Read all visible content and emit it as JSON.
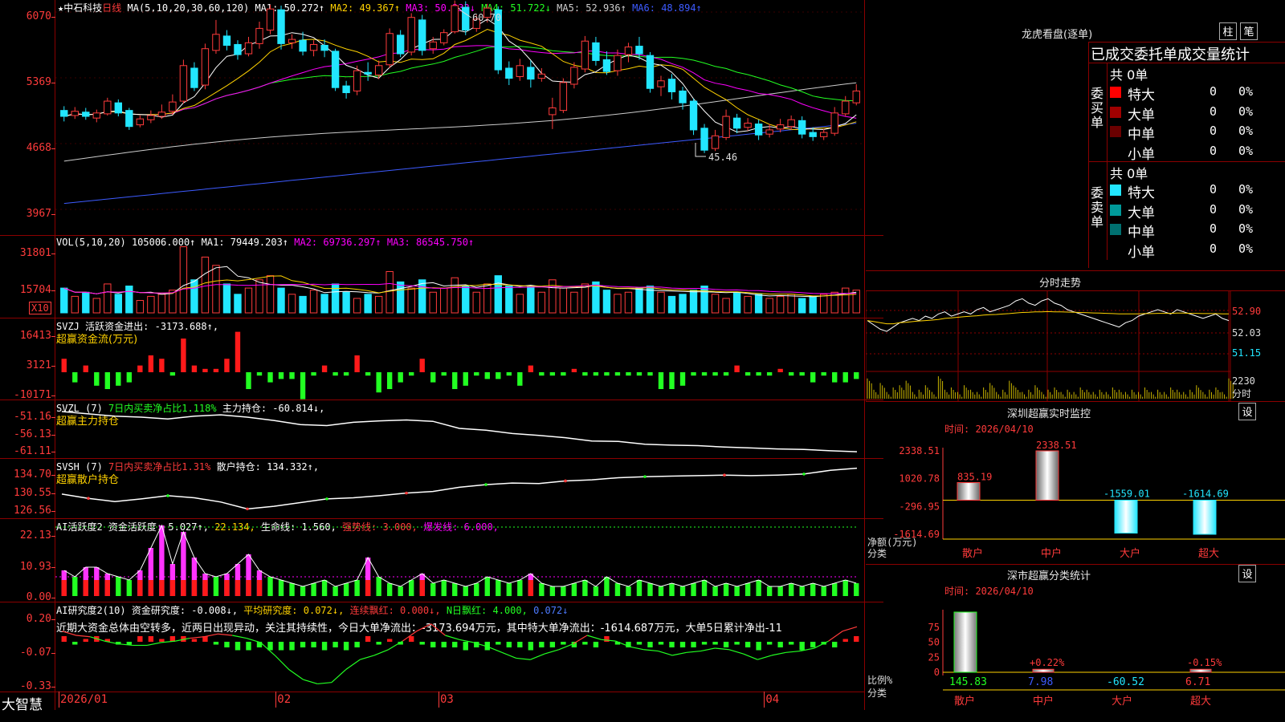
{
  "stock": {
    "name": "中石科技",
    "period": "日线",
    "ma_label": "MA(5,10,20,30,60,120)",
    "ma": [
      {
        "label": "MA1: 50.272↑",
        "color": "#ffffff"
      },
      {
        "label": "MA2: 49.367↑",
        "color": "#ffd200"
      },
      {
        "label": "MA3: 50.233↓",
        "color": "#ff00ff"
      },
      {
        "label": "MA4: 51.722↓",
        "color": "#22ff22"
      },
      {
        "label": "MA5: 52.936↑",
        "color": "#cccccc"
      },
      {
        "label": "MA6: 48.894↑",
        "color": "#3d5bff"
      }
    ],
    "price_ticks": [
      "6070",
      "5369",
      "4668",
      "3967"
    ],
    "high_label": "60.70",
    "low_label": "45.46",
    "candles": [
      [
        50.5,
        49.8,
        51.0,
        49.2
      ],
      [
        49.9,
        50.4,
        50.9,
        49.5
      ],
      [
        50.3,
        49.8,
        50.8,
        49.4
      ],
      [
        49.6,
        50.2,
        50.6,
        49.1
      ],
      [
        50.1,
        51.6,
        52.0,
        49.9
      ],
      [
        51.4,
        50.2,
        51.8,
        49.8
      ],
      [
        50.5,
        48.6,
        50.8,
        48.2
      ],
      [
        48.8,
        49.5,
        49.9,
        48.5
      ],
      [
        49.4,
        49.9,
        50.5,
        49.0
      ],
      [
        49.8,
        50.3,
        51.2,
        49.5
      ],
      [
        50.4,
        51.5,
        52.4,
        50.0
      ],
      [
        51.6,
        55.8,
        56.5,
        51.3
      ],
      [
        55.5,
        53.2,
        56.2,
        52.8
      ],
      [
        53.5,
        57.8,
        58.4,
        53.0
      ],
      [
        57.6,
        59.5,
        61.2,
        57.2
      ],
      [
        59.3,
        58.2,
        60.0,
        57.6
      ],
      [
        58.3,
        57.1,
        58.8,
        56.5
      ],
      [
        57.2,
        58.5,
        59.2,
        56.9
      ],
      [
        58.4,
        60.2,
        61.0,
        57.8
      ],
      [
        60.0,
        62.5,
        63.0,
        59.5
      ],
      [
        62.4,
        58.4,
        62.9,
        57.7
      ],
      [
        58.5,
        58.9,
        59.5,
        57.8
      ],
      [
        58.8,
        57.5,
        59.8,
        57.0
      ],
      [
        57.6,
        58.3,
        58.8,
        56.9
      ],
      [
        58.2,
        57.6,
        58.9,
        56.8
      ],
      [
        57.5,
        53.2,
        57.8,
        52.8
      ],
      [
        53.4,
        52.6,
        54.0,
        51.9
      ],
      [
        52.8,
        55.2,
        55.8,
        52.3
      ],
      [
        55.0,
        54.8,
        56.2,
        54.0
      ],
      [
        54.7,
        55.8,
        56.4,
        54.2
      ],
      [
        55.9,
        59.6,
        60.2,
        55.5
      ],
      [
        59.4,
        57.2,
        60.0,
        56.8
      ],
      [
        57.4,
        61.5,
        62.0,
        57.0
      ],
      [
        61.2,
        57.6,
        61.8,
        57.0
      ],
      [
        57.8,
        58.6,
        59.2,
        57.2
      ],
      [
        58.5,
        59.7,
        60.1,
        58.2
      ],
      [
        59.8,
        62.9,
        63.5,
        59.6
      ],
      [
        62.7,
        60.0,
        63.4,
        59.4
      ],
      [
        60.2,
        61.3,
        61.8,
        59.8
      ],
      [
        61.5,
        62.6,
        63.1,
        60.9
      ],
      [
        62.4,
        55.3,
        62.8,
        54.8
      ],
      [
        55.5,
        54.3,
        56.3,
        53.5
      ],
      [
        54.5,
        55.8,
        56.6,
        54.0
      ],
      [
        55.6,
        54.2,
        56.4,
        53.2
      ],
      [
        54.3,
        54.8,
        55.5,
        53.9
      ],
      [
        50.0,
        50.8,
        52.0,
        48.3
      ],
      [
        50.5,
        53.8,
        54.3,
        50.2
      ],
      [
        53.6,
        55.6,
        56.2,
        53.1
      ],
      [
        55.4,
        58.7,
        59.3,
        55.0
      ],
      [
        58.5,
        56.4,
        59.2,
        55.8
      ],
      [
        56.5,
        55.1,
        57.5,
        54.7
      ],
      [
        55.2,
        57.0,
        57.7,
        54.6
      ],
      [
        57.1,
        58.0,
        58.5,
        56.2
      ],
      [
        58.1,
        57.2,
        59.2,
        56.5
      ],
      [
        57.0,
        53.1,
        57.4,
        52.6
      ],
      [
        53.3,
        54.0,
        54.6,
        52.2
      ],
      [
        54.2,
        52.7,
        54.8,
        51.8
      ],
      [
        52.8,
        51.4,
        53.3,
        50.6
      ],
      [
        51.6,
        48.2,
        51.9,
        47.6
      ],
      [
        48.4,
        45.8,
        48.9,
        45.46
      ],
      [
        46.0,
        47.5,
        48.2,
        45.7
      ],
      [
        47.3,
        49.8,
        50.6,
        47.0
      ],
      [
        49.6,
        48.4,
        50.1,
        47.8
      ],
      [
        48.5,
        49.0,
        49.6,
        48.1
      ],
      [
        48.9,
        47.6,
        49.4,
        47.0
      ],
      [
        47.7,
        48.2,
        48.9,
        47.3
      ],
      [
        48.3,
        48.8,
        49.5,
        47.9
      ],
      [
        48.6,
        49.4,
        49.9,
        48.2
      ],
      [
        49.3,
        47.7,
        49.8,
        47.2
      ],
      [
        47.9,
        47.4,
        48.5,
        46.9
      ],
      [
        47.4,
        47.9,
        48.3,
        47.0
      ],
      [
        47.8,
        50.2,
        50.9,
        47.5
      ],
      [
        50.1,
        51.6,
        52.2,
        49.8
      ],
      [
        51.4,
        52.8,
        53.6,
        51.1
      ]
    ]
  },
  "volume": {
    "label": "VOL(5,10,20)",
    "value": "105006.000↑",
    "ma": [
      {
        "label": "MA1: 79449.203↑",
        "color": "#ffffff"
      },
      {
        "label": "MA2: 69736.297↑",
        "color": "#ff00ff"
      },
      {
        "label": "MA3: 86545.750↑",
        "color": "#ff00ff"
      }
    ],
    "ticks": [
      "31801",
      "15704"
    ],
    "unit": "X10",
    "bars": [
      12,
      8,
      10,
      7,
      14,
      9,
      13,
      6,
      8,
      9,
      11,
      32,
      16,
      27,
      23,
      14,
      9,
      12,
      16,
      18,
      12,
      9,
      8,
      11,
      9,
      14,
      10,
      7,
      9,
      8,
      20,
      15,
      12,
      16,
      10,
      12,
      17,
      13,
      10,
      14,
      18,
      13,
      9,
      13,
      10,
      16,
      12,
      10,
      14,
      15,
      11,
      9,
      10,
      12,
      13,
      10,
      8,
      9,
      11,
      13,
      9,
      7,
      10,
      8,
      9,
      7,
      8,
      9,
      7,
      8,
      9,
      10,
      12,
      11
    ]
  },
  "svzj": {
    "label": "SVZJ",
    "desc": "活跃资金进出: -3173.688↑,",
    "sub": "超赢资金流(万元)",
    "ticks": [
      "16413",
      "3121",
      "-10171"
    ],
    "bars": [
      4,
      -3,
      2,
      -4,
      -5,
      -4,
      -3,
      2,
      5,
      4,
      -1,
      10,
      2,
      1,
      1,
      4,
      12,
      -5,
      -1,
      -3,
      -2,
      -2,
      -8,
      -1,
      2,
      -1,
      -1,
      5,
      -1,
      -6,
      -5,
      -3,
      -1,
      4,
      -3,
      -1,
      -5,
      -4,
      -1,
      -2,
      -2,
      -1,
      -4,
      2,
      -1,
      -1,
      -1,
      1,
      -1,
      -1,
      -1,
      -1,
      -1,
      -1,
      -1,
      -5,
      -5,
      -4,
      -1,
      -1,
      -1,
      -1,
      2,
      -1,
      -1,
      -1,
      1,
      -1,
      -1,
      -3,
      -1,
      -3,
      -3,
      -2
    ]
  },
  "svzl": {
    "label": "SVZL (7)",
    "desc": "7日内买卖净占比1.118%",
    "hold": "主力持仓: -60.814↓,",
    "sub": "超赢主力持仓",
    "ticks": [
      "-51.16",
      "-56.13",
      "-61.11"
    ],
    "values": [
      -52.2,
      -52.7,
      -53.2,
      -53.4,
      -53.8,
      -53.2,
      -52.9,
      -53.4,
      -54.1,
      -55.0,
      -55.2,
      -54.5,
      -54.2,
      -54.0,
      -54.3,
      -55.8,
      -56.2,
      -56.9,
      -57.3,
      -57.8,
      -58.5,
      -58.6,
      -59.2,
      -59.4,
      -59.5,
      -59.8,
      -60.0,
      -60.2,
      -60.3,
      -60.6,
      -60.8
    ]
  },
  "svsh": {
    "label": "SVSH (7)",
    "desc": "7日内买卖净占比1.31%",
    "hold": "散户持仓: 134.332↑,",
    "sub": "超赢散户持仓",
    "ticks": [
      "134.70",
      "130.55",
      "126.56"
    ],
    "values": [
      129.8,
      129.0,
      128.4,
      128.9,
      129.5,
      129.1,
      128.3,
      127.0,
      127.5,
      128.2,
      128.9,
      129.1,
      129.5,
      130.0,
      130.3,
      131.1,
      131.6,
      131.9,
      131.8,
      132.3,
      132.5,
      132.9,
      133.1,
      133.2,
      133.3,
      133.4,
      133.3,
      133.4,
      133.6,
      134.3,
      134.7
    ]
  },
  "ai_active": {
    "label": "AI活跃度2",
    "desc": "资金活跃度: 5.027↑,",
    "v2": "22.134,",
    "life": "生命线: 1.560,",
    "strong": "强势线: 3.000,",
    "burst": "爆发线: 6.000,",
    "ticks": [
      "22.13",
      "10.93",
      "0.00"
    ],
    "bars": [
      8,
      6,
      9,
      9,
      7,
      6,
      5,
      8,
      15,
      22,
      10,
      20,
      12,
      7,
      6,
      7,
      10,
      13,
      8,
      6,
      5,
      4,
      3,
      4,
      5,
      3,
      4,
      5,
      12,
      6,
      4,
      3,
      5,
      7,
      4,
      5,
      4,
      3,
      4,
      6,
      5,
      4,
      5,
      7,
      4,
      3,
      3,
      4,
      5,
      3,
      6,
      4,
      3,
      5,
      4,
      3,
      4,
      3,
      4,
      5,
      3,
      4,
      3,
      4,
      5,
      3,
      3,
      4,
      3,
      4,
      3,
      4,
      5,
      4
    ]
  },
  "ai_research": {
    "label": "AI研究度2(10)",
    "desc": "资金研究度: -0.008↓,",
    "avg": "平均研究度: 0.072↓,",
    "cont": "连续飘红: 0.000↓,",
    "nred": "N日飘红: 4.000,",
    "last": "0.072↓",
    "ticks": [
      "0.20",
      "-0.07",
      "-0.33"
    ],
    "note": "近期大资金总体由空转多，近两日出现异动，关注其持续性，今日大单净流出：-3173.694万元，其中特大单净流出：-1614.687万元，大单5日累计净出-11",
    "bars": [
      2,
      -1,
      1,
      2,
      1,
      -1,
      -1,
      2,
      2,
      1,
      2,
      2,
      1,
      2,
      -1,
      -2,
      -3,
      -3,
      -2,
      -3,
      -3,
      -3,
      -2,
      -2,
      -3,
      -2,
      -3,
      -2,
      2,
      -1,
      1,
      -1,
      2,
      -1,
      -2,
      -2,
      -2,
      -3,
      -2,
      -3,
      -1,
      -2,
      -2,
      -3,
      -2,
      -2,
      -1,
      -2,
      -1,
      -2,
      2,
      -1,
      -2,
      -1,
      -2,
      -1,
      -2,
      -2,
      -2,
      -1,
      -1,
      -2,
      -1,
      -2,
      -3,
      -1,
      -2,
      -1,
      -3,
      -2,
      -1,
      -2,
      1,
      2
    ],
    "line": [
      0.05,
      0.02,
      0.01,
      -0.02,
      -0.04,
      -0.05,
      -0.05,
      -0.03,
      -0.02,
      0.0,
      0.01,
      0.03,
      0.02,
      0.0,
      -0.03,
      -0.12,
      -0.22,
      -0.29,
      -0.32,
      -0.31,
      -0.22,
      -0.15,
      -0.12,
      -0.08,
      -0.02,
      0.05,
      0.1,
      0.02,
      -0.01,
      -0.03,
      -0.06,
      -0.1,
      -0.14,
      -0.15,
      -0.11,
      -0.08,
      -0.04,
      0.02,
      -0.01,
      -0.02,
      -0.06,
      -0.08,
      -0.09,
      -0.12,
      -0.1,
      -0.09,
      -0.07,
      -0.08,
      -0.11,
      -0.15,
      -0.12,
      -0.1,
      -0.09,
      -0.07,
      -0.02,
      0.05,
      0.08
    ]
  },
  "x_axis": [
    {
      "label": "2026/01",
      "i": 0
    },
    {
      "label": "02",
      "i": 20
    },
    {
      "label": "03",
      "i": 35
    },
    {
      "label": "04",
      "i": 65
    }
  ],
  "logo": "大智慧",
  "lhb": {
    "title": "龙虎看盘(逐单)",
    "btn1": "柱",
    "btn2": "笔",
    "section": "已成交委托单成交量统计",
    "buy_label": "委买单",
    "sell_label": "委卖单",
    "buy_total": "共 0单",
    "sell_total": "共 0单",
    "buy_rows": [
      {
        "name": "特大",
        "v": "0",
        "p": "0%",
        "color": "#ff0000"
      },
      {
        "name": "大单",
        "v": "0",
        "p": "0%",
        "color": "#a00000"
      },
      {
        "name": "中单",
        "v": "0",
        "p": "0%",
        "color": "#6a0000"
      },
      {
        "name": "小单",
        "v": "0",
        "p": "0%",
        "color": ""
      }
    ],
    "sell_rows": [
      {
        "name": "特大",
        "v": "0",
        "p": "0%",
        "color": "#22e6ff"
      },
      {
        "name": "大单",
        "v": "0",
        "p": "0%",
        "color": "#009a9a"
      },
      {
        "name": "中单",
        "v": "0",
        "p": "0%",
        "color": "#007070"
      },
      {
        "name": "小单",
        "v": "0",
        "p": "0%",
        "color": ""
      }
    ]
  },
  "intraday": {
    "title": "分时走势",
    "ticks": [
      "52.90",
      "52.03",
      "51.15"
    ],
    "vol_tick": "2230",
    "vol_unit": "分时",
    "prices": [
      52.6,
      52.4,
      52.2,
      52.1,
      52.3,
      52.5,
      52.6,
      52.7,
      52.6,
      52.8,
      52.7,
      52.9,
      53.0,
      52.8,
      52.9,
      53.0,
      52.9,
      53.1,
      53.2,
      53.0,
      53.1,
      53.2,
      53.3,
      53.5,
      53.6,
      53.4,
      53.3,
      53.5,
      53.6,
      53.4,
      53.3,
      53.1,
      53.0,
      52.9,
      52.8,
      52.7,
      52.6,
      52.5,
      52.4,
      52.3,
      52.5,
      52.6,
      52.8,
      52.9,
      53.0,
      53.1,
      53.0,
      52.9,
      53.1,
      53.0,
      52.9,
      52.8,
      52.7,
      52.8,
      52.9,
      52.7,
      52.6
    ],
    "avg": [
      52.6,
      52.55,
      52.5,
      52.45,
      52.45,
      52.5,
      52.52,
      52.55,
      52.58,
      52.6,
      52.62,
      52.65,
      52.7,
      52.72,
      52.75,
      52.78,
      52.8,
      52.82,
      52.85,
      52.87,
      52.88,
      52.9,
      52.92,
      52.95,
      52.97,
      52.98,
      53.0,
      53.0,
      53.01,
      53.0,
      53.0,
      52.99,
      52.98,
      52.97,
      52.96,
      52.95,
      52.94,
      52.93,
      52.92,
      52.91,
      52.91,
      52.91,
      52.91,
      52.92,
      52.92,
      52.93,
      52.93,
      52.93,
      52.94,
      52.94,
      52.93,
      52.93,
      52.92,
      52.92,
      52.92,
      52.91,
      52.91
    ],
    "vols": [
      9,
      4,
      7,
      3,
      5,
      6,
      8,
      3,
      4,
      6,
      3,
      10,
      4,
      5,
      3,
      6,
      4,
      3,
      5,
      7,
      3,
      4,
      8,
      5,
      3,
      4,
      6,
      3,
      4,
      5,
      3,
      4,
      3,
      5,
      4,
      3,
      4,
      3,
      5,
      4,
      3,
      4,
      3,
      5,
      3,
      4,
      3,
      5,
      4,
      3,
      4,
      6,
      3,
      4,
      5,
      3,
      9
    ]
  },
  "sz_monitor": {
    "title": "深圳超赢实时监控",
    "btn": "设",
    "time": "时间: 2026/04/10",
    "ticks": [
      "2338.51",
      "1020.78",
      "-296.95",
      "-1614.69"
    ],
    "y_label1": "净额(万元)",
    "y_label2": "分类",
    "cats": [
      "散户",
      "中户",
      "大户",
      "超大"
    ],
    "values": [
      835.19,
      2338.51,
      -1559.01,
      -1614.69
    ],
    "labels": [
      "835.19",
      "2338.51",
      "-1559.01",
      "-1614.69"
    ],
    "ylim": [
      -1614.69,
      2338.51
    ]
  },
  "sz_class": {
    "title": "深市超赢分类统计",
    "btn": "设",
    "time": "时间: 2026/04/10",
    "ticks": [
      "75",
      "50",
      "25",
      "0"
    ],
    "y_label1": "比例%",
    "y_label2": "分类",
    "cats": [
      "散户",
      "中户",
      "大户",
      "超大"
    ],
    "bar_values": [
      100,
      5,
      0,
      5
    ],
    "bar_labels": [
      "",
      "+0.22%",
      "",
      "-0.15%"
    ],
    "bottom_values": [
      "145.83",
      "7.98",
      "-60.52",
      "6.71"
    ]
  }
}
